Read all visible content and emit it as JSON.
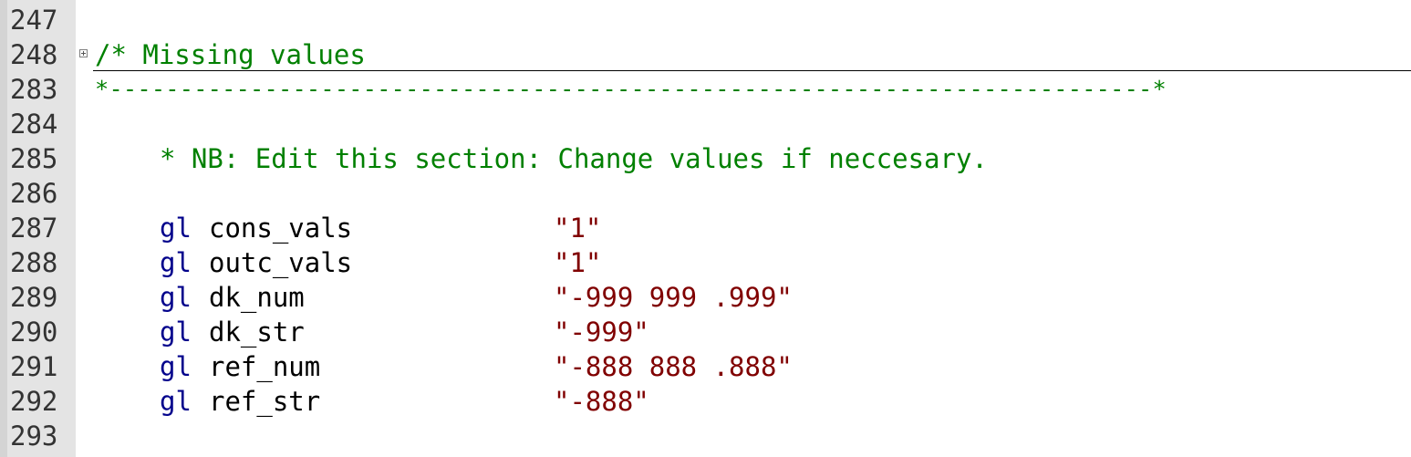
{
  "editor": {
    "lines": [
      {
        "num": "247"
      },
      {
        "num": "248",
        "text": "/* Missing values"
      },
      {
        "num": "283",
        "text": "*--------------------------------------------------------------------------*"
      },
      {
        "num": "284"
      },
      {
        "num": "285",
        "text": "* NB: Edit this section: Change values if neccesary."
      },
      {
        "num": "286"
      },
      {
        "num": "287",
        "kw": "gl",
        "name": "cons_vals",
        "value": "\"1\""
      },
      {
        "num": "288",
        "kw": "gl",
        "name": "outc_vals",
        "value": "\"1\""
      },
      {
        "num": "289",
        "kw": "gl",
        "name": "dk_num",
        "value": "\"-999 999 .999\""
      },
      {
        "num": "290",
        "kw": "gl",
        "name": "dk_str",
        "value": "\"-999\""
      },
      {
        "num": "291",
        "kw": "gl",
        "name": "ref_num",
        "value": "\"-888 888 .888\""
      },
      {
        "num": "292",
        "kw": "gl",
        "name": "ref_str",
        "value": "\"-888\""
      },
      {
        "num": "293"
      }
    ]
  },
  "colors": {
    "comment": "#008000",
    "keyword": "#00008b",
    "string": "#800000",
    "gutter": "#e4e4e4"
  }
}
